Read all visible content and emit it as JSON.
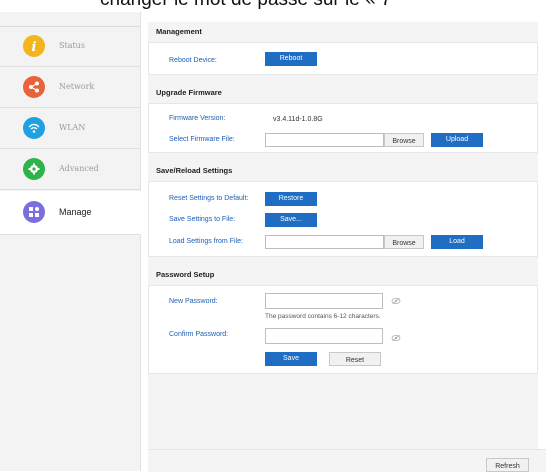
{
  "caption": "changer le mot de passe sur le « 7",
  "sidebar": {
    "items": [
      {
        "label": "Status",
        "icon": "info-icon",
        "color": "#f2b51c"
      },
      {
        "label": "Network",
        "icon": "share-icon",
        "color": "#e8633a"
      },
      {
        "label": "WLAN",
        "icon": "wifi-icon",
        "color": "#1fa0e0"
      },
      {
        "label": "Advanced",
        "icon": "gear-icon",
        "color": "#2db34a"
      },
      {
        "label": "Manage",
        "icon": "grid-icon",
        "color": "#7b6fe0"
      }
    ]
  },
  "management": {
    "title": "Management",
    "reboot_label": "Reboot Device:",
    "reboot_button": "Reboot"
  },
  "firmware": {
    "title": "Upgrade Firmware",
    "version_label": "Firmware Version:",
    "version_value": "v3.4.11d-1.0.8G",
    "select_label": "Select Firmware File:",
    "file_value": "",
    "browse_button": "Browse",
    "upload_button": "Upload"
  },
  "settings": {
    "title": "Save/Reload Settings",
    "reset_label": "Reset Settings to Default:",
    "restore_button": "Restore",
    "save_label": "Save Settings to File:",
    "save_button": "Save...",
    "load_label": "Load Settings from File:",
    "file_value": "",
    "browse_button": "Browse",
    "load_button": "Load"
  },
  "password": {
    "title": "Password Setup",
    "new_label": "New Password:",
    "new_value": "",
    "hint": "The password contains 6-12 characters.",
    "confirm_label": "Confirm Password:",
    "confirm_value": "",
    "save_button": "Save",
    "reset_button": "Reset"
  },
  "footer": {
    "refresh_button": "Refresh"
  },
  "colors": {
    "accent": "#1f6ec4",
    "label_blue": "#1e5fb3"
  }
}
